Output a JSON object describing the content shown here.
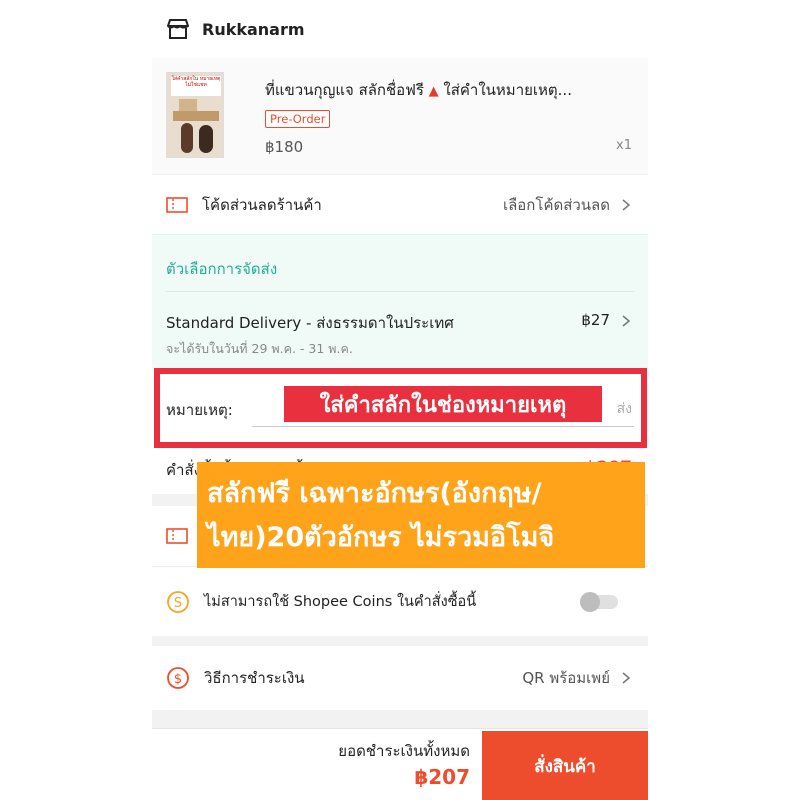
{
  "shop": {
    "name": "Rukkanarm",
    "icon": "shop-icon"
  },
  "product": {
    "title": "ที่แขวนกุญแจ สลักชื่อฟรี ",
    "title_marker": "▲",
    "title_suffix": " ใส่คำในหมายเหตุ...",
    "badge": "Pre-Order",
    "price": "฿180",
    "quantity": "x1",
    "thumb_text": "ใส่คำสลักใน หมายเหตุ ไม่ใช่แชท"
  },
  "shop_voucher": {
    "label": "โค้ดส่วนลดร้านค้า",
    "action": "เลือกโค้ดส่วนลด",
    "icon": "ticket-icon"
  },
  "shipping": {
    "heading": "ตัวเลือกการจัดส่ง",
    "method": "Standard Delivery - ส่งธรรมดาในประเทศ",
    "price": "฿27",
    "eta": "จะได้รับในวันที่ 29 พ.ค. - 31 พ.ค."
  },
  "note": {
    "label": "หมายเหตุ:",
    "placeholder_tail": "ส่ง"
  },
  "order_total": {
    "label": "คำสั่งซื้อทั้งหมด (1 ชิ้น):",
    "price": "฿207"
  },
  "coins": {
    "label": "ไม่สามารถใช้ Shopee Coins ในคำสั่งซื้อนี้",
    "enabled": false
  },
  "payment": {
    "label": "วิธีการชำระเงิน",
    "value": "QR พร้อมเพย์",
    "icon": "dollar-icon"
  },
  "checkout": {
    "total_label": "ยอดชำระเงินทั้งหมด",
    "total_price": "฿207",
    "button": "สั่งสินค้า"
  },
  "annotations": {
    "note_banner": "ใส่คำสลักในช่องหมายเหตุ",
    "info_line1": "สลักฟรี เฉพาะอักษร(อังกฤษ/",
    "info_line2": "ไทย)20ตัวอักษร ไม่รวมอิโมจิ"
  },
  "colors": {
    "accent": "#ee4d2d",
    "teal": "#26aa99",
    "banner_red": "#e8303f",
    "banner_orange": "#ffa31a"
  }
}
